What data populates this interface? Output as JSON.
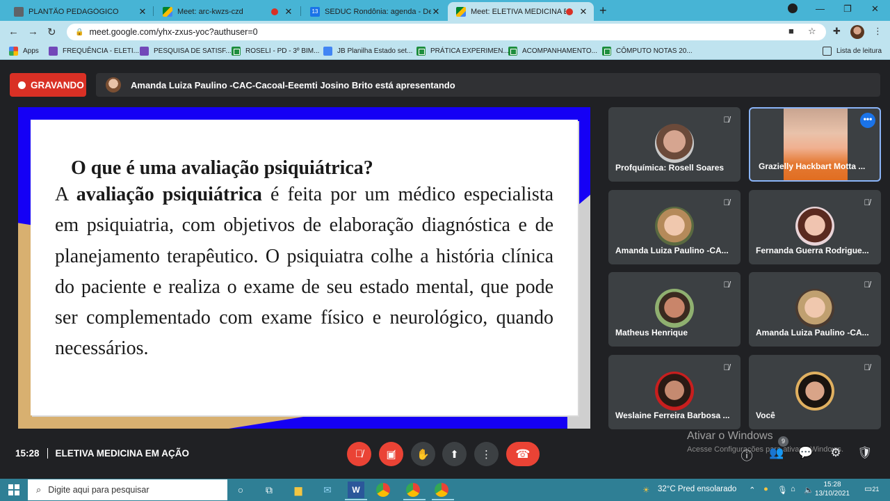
{
  "browser": {
    "tabs": [
      {
        "title": "PLANTÃO PEDAGÓGICO"
      },
      {
        "title": "Meet: arc-kwzs-czd"
      },
      {
        "title": "SEDUC Rondônia: agenda - Detalhes"
      },
      {
        "title": "Meet: ELETIVA MEDICINA EM AÇÃO"
      }
    ],
    "calendar_tab_day": "13",
    "close_glyph": "✕",
    "new_tab_glyph": "+",
    "window_controls": [
      "—",
      "❐",
      "✕"
    ],
    "url": "meet.google.com/yhx-zxus-yoc?authuser=0",
    "bookmarks": [
      {
        "label": "Apps",
        "icon": "apps-icon"
      },
      {
        "label": "FREQUÊNCIA - ELETI...",
        "icon": "forms-icon"
      },
      {
        "label": "PESQUISA DE SATISF...",
        "icon": "forms-icon"
      },
      {
        "label": "ROSELI - PD - 3º BIM...",
        "icon": "sheets-icon"
      },
      {
        "label": "JB Planilha Estado set...",
        "icon": "docs-icon"
      },
      {
        "label": "PRÁTICA EXPERIMEN...",
        "icon": "sheets-icon"
      },
      {
        "label": "ACOMPANHAMENTO...",
        "icon": "sheets-icon"
      },
      {
        "label": "CÔMPUTO NOTAS 20...",
        "icon": "sheets-icon"
      }
    ],
    "reading_list": "Lista de leitura"
  },
  "meet": {
    "recording_label": "GRAVANDO",
    "presenting_text": "Amanda Luiza Paulino -CAC-Cacoal-Eeemti Josino Brito está apresentando",
    "slide": {
      "title": "O que é uma avaliação psiquiátrica?",
      "body_prefix": "A ",
      "body_bold": "avaliação psiquiátrica",
      "body_rest": " é feita por um médico especialista em psiquiatria, com objetivos de elaboração diagnóstica e de planejamento terapêutico. O psiquiatra colhe a história clínica do paciente e realiza o exame de seu estado mental, que pode ser complementado com exame físico e neurológico, quando necessários."
    },
    "participants": [
      {
        "name": "Profquímica: Rosell Soares"
      },
      {
        "name": "Grazielly Hackbart Motta ..."
      },
      {
        "name": "Amanda Luiza Paulino -CA..."
      },
      {
        "name": "Fernanda Guerra Rodrigue..."
      },
      {
        "name": "Matheus Henrique"
      },
      {
        "name": "Amanda Luiza Paulino -CA..."
      },
      {
        "name": "Weslaine Ferreira Barbosa ..."
      },
      {
        "name": "Você"
      }
    ],
    "more_options_glyph": "•••",
    "time": "15:28",
    "meeting_name": "ELETIVA MEDICINA EM AÇÃO",
    "participant_count": "9",
    "activate_title": "Ativar o Windows",
    "activate_sub": "Acesse Configurações para ativar o Windows."
  },
  "taskbar": {
    "search_placeholder": "Digite aqui para pesquisar",
    "weather": "32°C  Pred ensolarado",
    "time": "15:28",
    "date": "13/10/2021",
    "notifications": "21"
  },
  "colors": {
    "record_red": "#d93025",
    "meet_bg": "#202124",
    "tile_bg": "#3c4043",
    "chrome_tab": "#47b4d5",
    "taskbar": "#2f7f95"
  }
}
